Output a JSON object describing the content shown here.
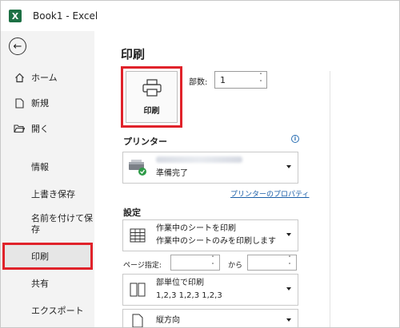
{
  "window": {
    "title": "Book1  -  Excel",
    "app_icon": "X"
  },
  "sidebar": {
    "items": [
      {
        "label": "ホーム",
        "icon": "home-icon"
      },
      {
        "label": "新規",
        "icon": "new-file-icon"
      },
      {
        "label": "開く",
        "icon": "folder-open-icon"
      },
      {
        "label": "情報"
      },
      {
        "label": "上書き保存"
      },
      {
        "label_line1": "名前を付けて保",
        "label_line2": "存"
      },
      {
        "label": "印刷",
        "active": true
      },
      {
        "label": "共有"
      },
      {
        "label": "エクスポート"
      }
    ]
  },
  "print": {
    "title": "印刷",
    "button_label": "印刷",
    "copies_label": "部数:",
    "copies_value": "1"
  },
  "printer": {
    "section_title": "プリンター",
    "status": "準備完了",
    "properties_link": "プリンターのプロパティ"
  },
  "settings": {
    "section_title": "設定",
    "what_to_print": {
      "title": "作業中のシートを印刷",
      "subtitle": "作業中のシートのみを印刷します"
    },
    "pages_label": "ページ指定:",
    "pages_from": "",
    "pages_to_label": "から",
    "pages_to": "",
    "collation": {
      "title": "部単位で印刷",
      "subtitle": "1,2,3    1,2,3    1,2,3"
    },
    "orientation": {
      "title": "縦方向"
    }
  },
  "colors": {
    "accent_red": "#e0222a",
    "excel_green": "#1d7044",
    "link_blue": "#1a5ea8"
  }
}
